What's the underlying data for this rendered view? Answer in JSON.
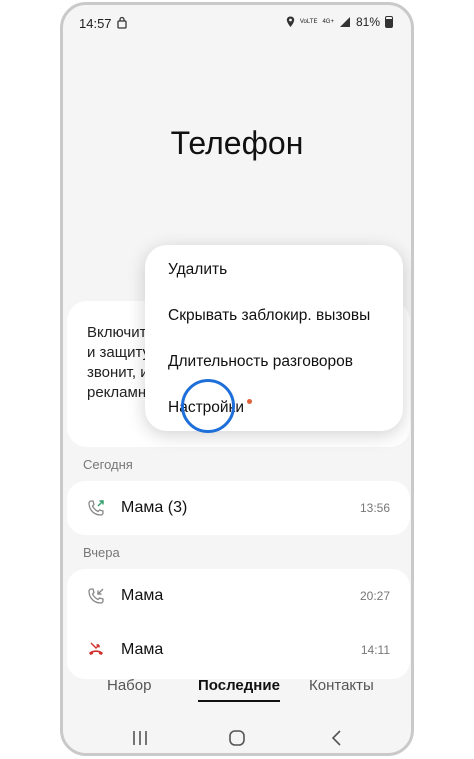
{
  "status_bar": {
    "time": "14:57",
    "network_top": "VoLTE",
    "network_mid": "4G+",
    "battery": "81%"
  },
  "app": {
    "title": "Телефон"
  },
  "promo": {
    "text": "Включит\nи защиту\nзвонит, и\nрекламн"
  },
  "menu": {
    "items": [
      {
        "label": "Удалить"
      },
      {
        "label": "Скрывать заблокир. вызовы"
      },
      {
        "label": "Длительность разговоров"
      },
      {
        "label": "Настройки"
      }
    ]
  },
  "sections": {
    "today": "Сегодня",
    "yesterday": "Вчера"
  },
  "calls": {
    "today": [
      {
        "name": "Мама (3)",
        "time": "13:56",
        "type": "outgoing"
      }
    ],
    "yesterday": [
      {
        "name": "Мама",
        "time": "20:27",
        "type": "incoming"
      },
      {
        "name": "Мама",
        "time": "14:11",
        "type": "missed"
      }
    ]
  },
  "tabs": [
    {
      "label": "Набор"
    },
    {
      "label": "Последние",
      "active": true
    },
    {
      "label": "Контакты"
    }
  ],
  "colors": {
    "accent_ring": "#1e6fd9",
    "notification_dot": "#e0613a",
    "outgoing_call": "#2e9e6a",
    "missed_call": "#d2332f"
  }
}
